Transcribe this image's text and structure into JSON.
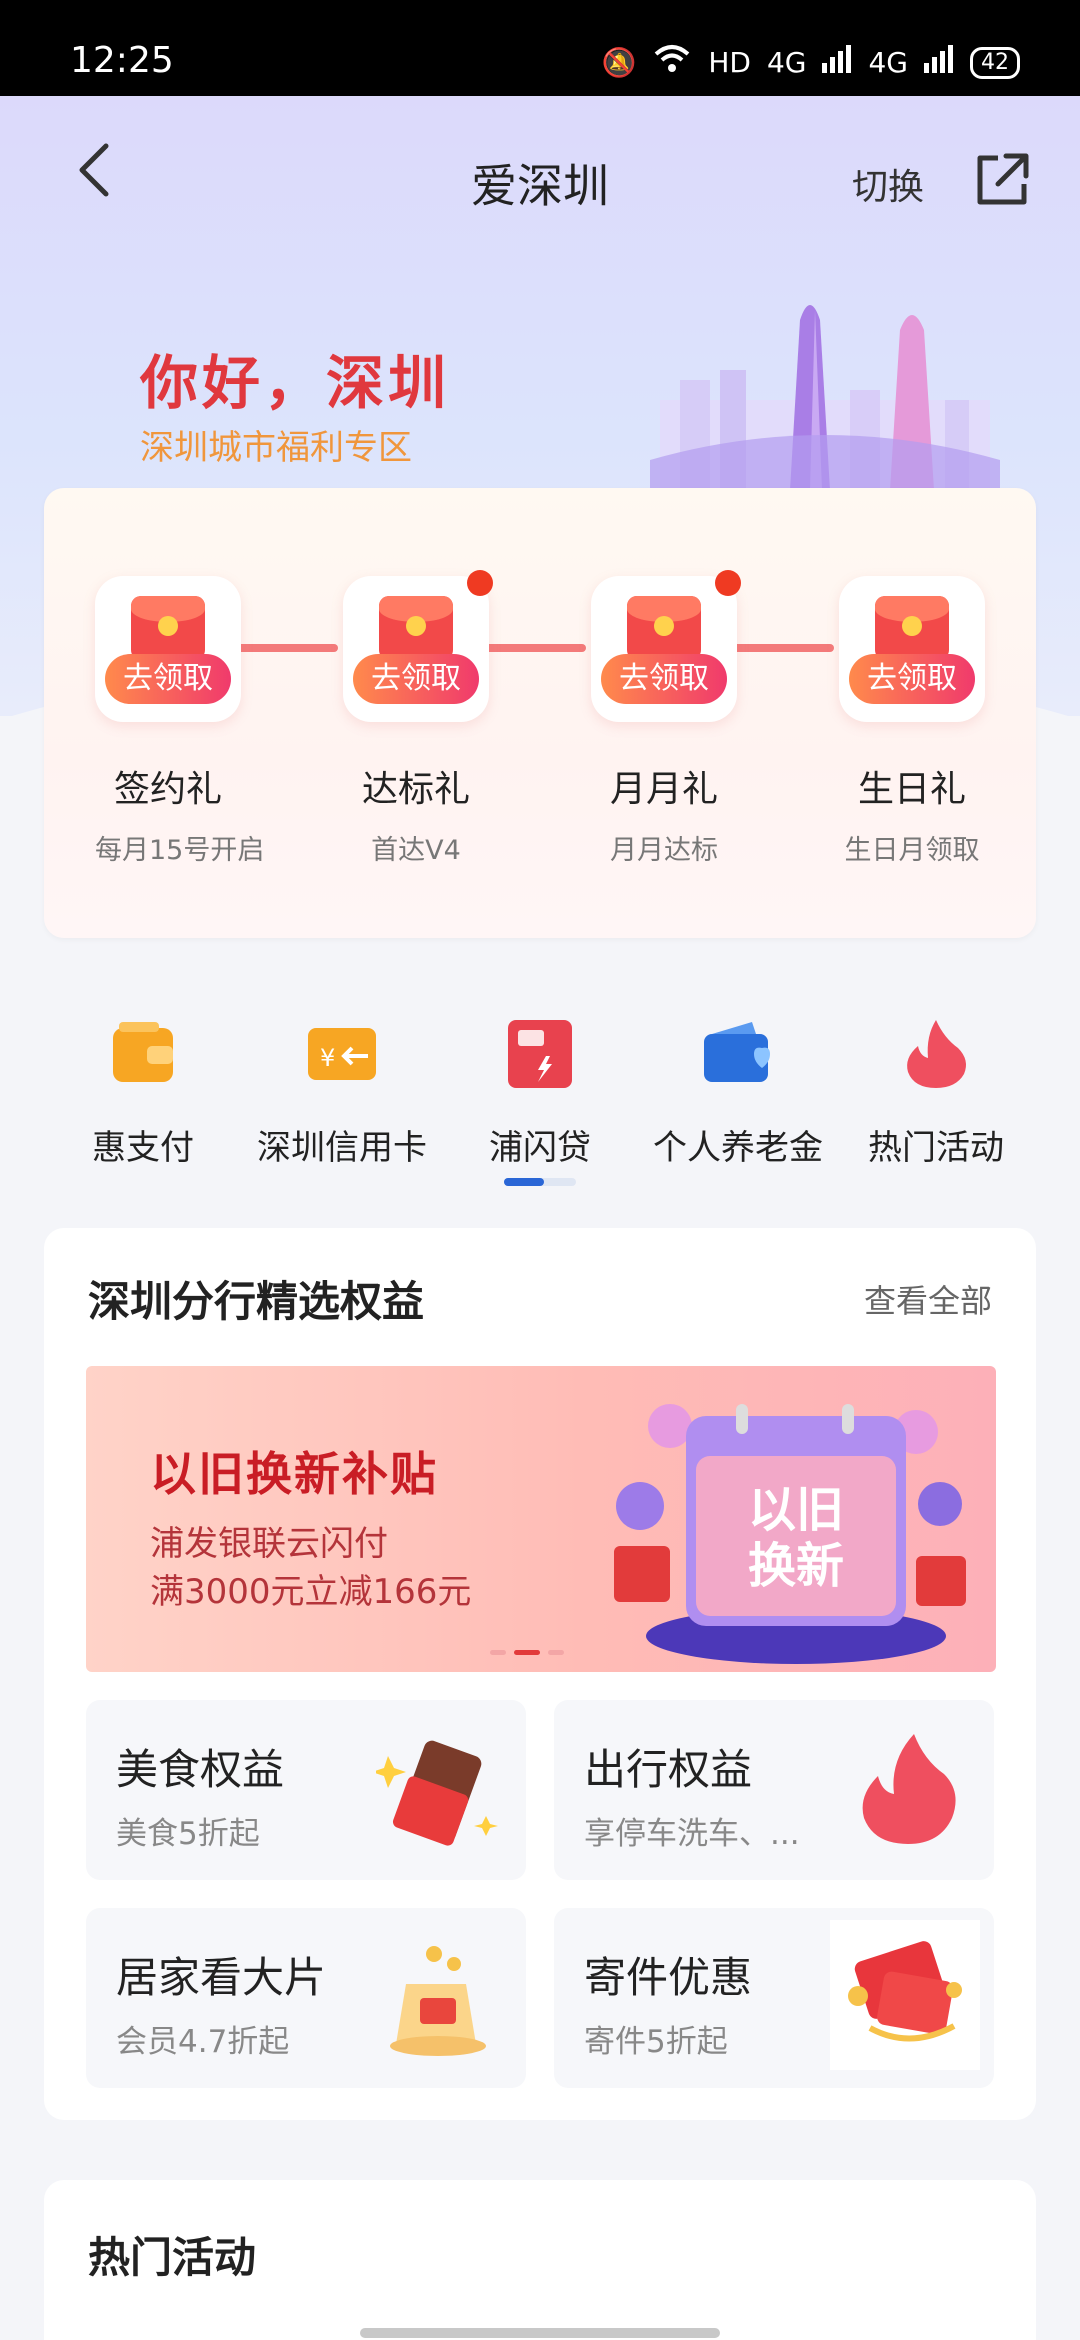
{
  "status_bar": {
    "time": "12:25",
    "network": "HD",
    "signal_1": "4G",
    "signal_2": "4G",
    "battery": "42"
  },
  "nav": {
    "title": "爱深圳",
    "switch_label": "切换"
  },
  "hero": {
    "greeting": "你好，深圳",
    "subtitle": "深圳城市福利专区"
  },
  "gifts": [
    {
      "pill": "去领取",
      "name": "签约礼",
      "desc": "每月15号开启",
      "has_dot": false
    },
    {
      "pill": "去领取",
      "name": "达标礼",
      "desc": "首达V4",
      "has_dot": true
    },
    {
      "pill": "去领取",
      "name": "月月礼",
      "desc": "月月达标",
      "has_dot": true
    },
    {
      "pill": "去领取",
      "name": "生日礼",
      "desc": "生日月领取",
      "has_dot": false
    }
  ],
  "quick_links": [
    {
      "label": "惠支付",
      "icon": "wallet-icon",
      "color": "#f7a623"
    },
    {
      "label": "深圳信用卡",
      "icon": "credit-card-icon",
      "color": "#f7a623"
    },
    {
      "label": "浦闪贷",
      "icon": "loan-icon",
      "color": "#e8424e"
    },
    {
      "label": "个人养老金",
      "icon": "heart-wallet-icon",
      "color": "#2a6fdb"
    },
    {
      "label": "热门活动",
      "icon": "flame-icon",
      "color": "#ef4f5f"
    }
  ],
  "benefits": {
    "title": "深圳分行精选权益",
    "see_all": "查看全部",
    "banner": {
      "title": "以旧换新补贴",
      "line1": "浦发银联云闪付",
      "line2": "满3000元立减166元",
      "art_text_1": "以旧",
      "art_text_2": "换新"
    },
    "tiles": [
      {
        "title": "美食权益",
        "subtitle": "美食5折起",
        "icon": "chocolate-icon"
      },
      {
        "title": "出行权益",
        "subtitle": "享停车洗车、...",
        "icon": "flame-icon"
      },
      {
        "title": "居家看大片",
        "subtitle": "会员4.7折起",
        "icon": "cinema-gift-icon"
      },
      {
        "title": "寄件优惠",
        "subtitle": "寄件5折起",
        "icon": "red-envelope-icon"
      }
    ]
  },
  "hot": {
    "title": "热门活动"
  }
}
